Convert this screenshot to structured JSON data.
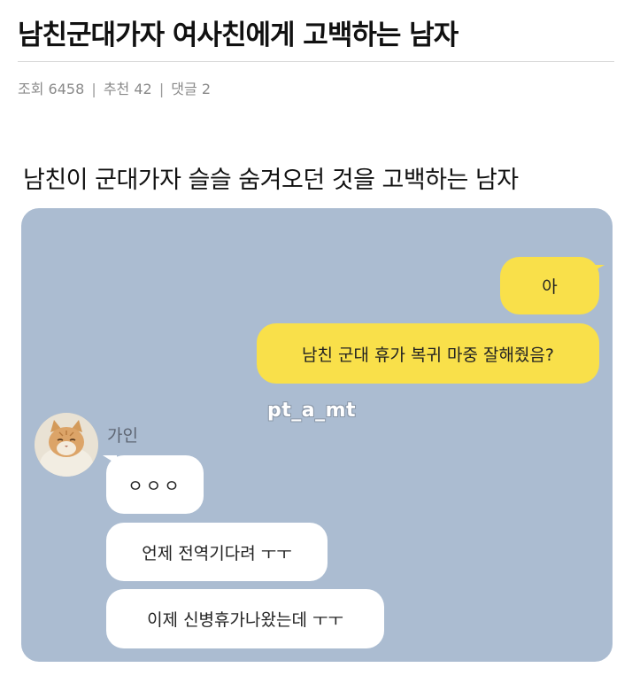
{
  "post": {
    "title": "남친군대가자 여사친에게 고백하는 남자",
    "meta": {
      "views": "조회 6458",
      "recommend": "추천 42",
      "comments": "댓글 2",
      "separator": "|"
    },
    "subheading": "남친이 군대가자 슬슬 숨겨오던 것을 고백하는 남자"
  },
  "chat": {
    "background_color": "#abbcd1",
    "my_bubble_color": "#f9e04a",
    "their_bubble_color": "#ffffff",
    "watermark": "pt_a_mt",
    "sender_name": "가인",
    "my_messages": [
      {
        "text": "아"
      },
      {
        "text": "남친 군대 휴가 복귀 마중 잘해줬음?"
      }
    ],
    "their_messages": [
      {
        "text": "ㅇㅇㅇ"
      },
      {
        "text": "언제 전역기다려 ㅜㅜ"
      },
      {
        "text": "이제 신병휴가나왔는데 ㅜㅜ"
      }
    ]
  }
}
